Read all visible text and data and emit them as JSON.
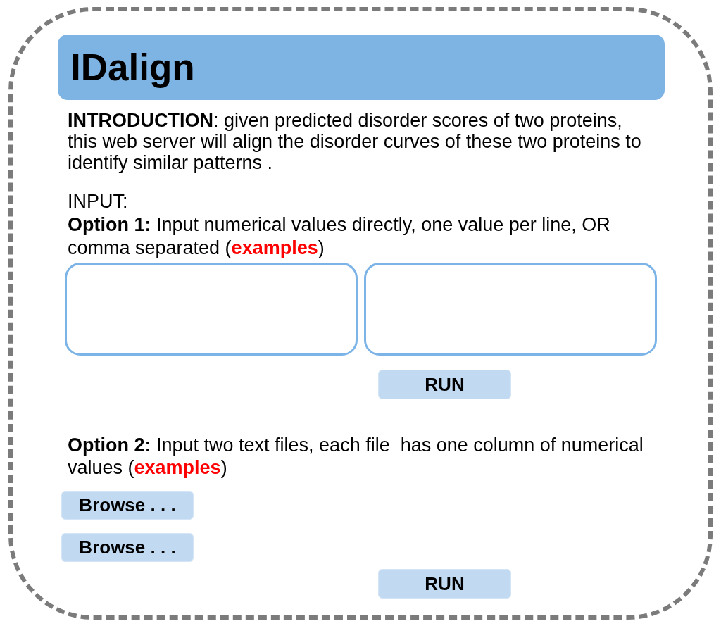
{
  "header": {
    "title": "IDalign"
  },
  "introduction": "**INTRODUCTION**: given predicted disorder scores of two proteins, this web server will align the disorder curves of these two proteins to identify similar patterns .",
  "input": {
    "heading": "INPUT:",
    "option_1": {
      "description": "**Option 1:** Input numerical values directly, one value per line, OR comma separated (",
      "link": "examples",
      "after_link": ")",
      "input_boxes": [
        {
          "kind": "textarea"
        },
        {
          "kind": "textarea"
        }
      ],
      "run_button": "RUN"
    },
    "option_2": {
      "description": "**Option 2:** Input two text files, each file  has one column of numerical values (",
      "link": "examples",
      "after_link": ")",
      "browse_buttons": [
        "Browse . . .",
        "Browse . . ."
      ],
      "run_button": "RUN"
    }
  }
}
